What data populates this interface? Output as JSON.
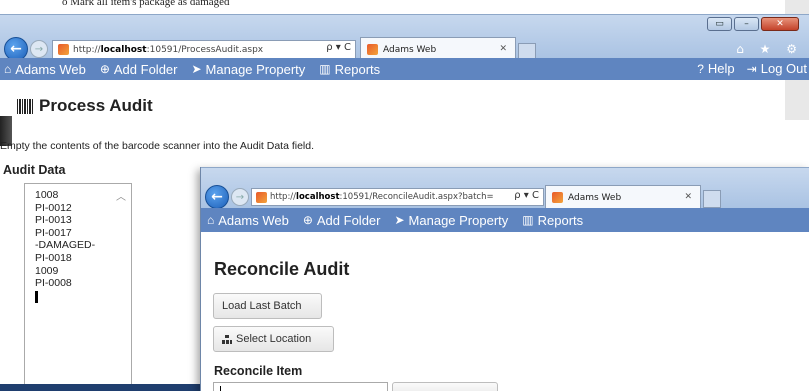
{
  "doc": {
    "text_line": "o   Mark all item's package as damaged"
  },
  "back_window": {
    "address_prefix": "http://",
    "address_host": "localhost",
    "address_rest": ":10591/ProcessAudit.aspx",
    "address_tools": "ρ ▾ C",
    "tab_title": "Adams Web",
    "tab_close": "✕",
    "window_buttons": [
      "▭",
      "–",
      "✕"
    ],
    "chrome_icons": "⌂ ★ ⚙",
    "nav": {
      "brand": "Adams Web",
      "add_folder": "Add Folder",
      "manage_property": "Manage Property",
      "reports": "Reports",
      "help": "Help",
      "logout": "Log Out"
    },
    "page_title": "Process Audit",
    "instructions": "Empty the contents of the barcode scanner into the Audit Data field.",
    "audit_data_label": "Audit Data",
    "audit_data_lines": [
      "1008",
      "PI-0012",
      "PI-0013",
      "PI-0017",
      "-DAMAGED-",
      "PI-0018",
      "1009",
      "PI-0008"
    ]
  },
  "front_window": {
    "address_prefix": "http://",
    "address_host": "localhost",
    "address_rest": ":10591/ReconcileAudit.aspx?batch=",
    "address_tools": "ρ ▾ C",
    "tab_title": "Adams Web",
    "tab_close": "✕",
    "nav": {
      "brand": "Adams Web",
      "add_folder": "Add Folder",
      "manage_property": "Manage Property",
      "reports": "Reports"
    },
    "page_title": "Reconcile Audit",
    "load_last_batch": "Load Last Batch",
    "select_location": "Select Location",
    "reconcile_item_label": "Reconcile Item"
  },
  "colors": {
    "navbar": "#5f85c0",
    "chrome": "#aac3e3"
  }
}
